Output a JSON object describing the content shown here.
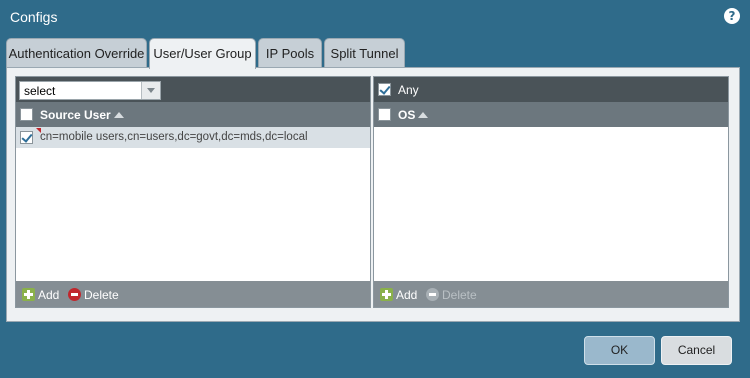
{
  "dialog": {
    "title": "Configs",
    "help_icon": "help-icon",
    "help_glyph": "?"
  },
  "tabs": [
    {
      "label": "Authentication Override",
      "active": false
    },
    {
      "label": "User/User Group",
      "active": true
    },
    {
      "label": "IP Pools",
      "active": false
    },
    {
      "label": "Split Tunnel",
      "active": false
    }
  ],
  "left_pane": {
    "select_value": "select",
    "column_header": "Source User",
    "rows": [
      {
        "checked": true,
        "value": "cn=mobile users,cn=users,dc=govt,dc=mds,dc=local"
      }
    ],
    "add_label": "Add",
    "delete_label": "Delete"
  },
  "right_pane": {
    "any_label": "Any",
    "any_checked": true,
    "column_header": "OS",
    "add_label": "Add",
    "delete_label": "Delete",
    "delete_disabled": true
  },
  "buttons": {
    "ok": "OK",
    "cancel": "Cancel"
  },
  "colors": {
    "dialog_bg": "#2f6b8a",
    "pane_header": "#4a5358",
    "column_header": "#6c777e",
    "footer": "#858e94",
    "add_green": "#8ab14a",
    "delete_red": "#c1272d",
    "ok_button": "#9ab8cc"
  }
}
